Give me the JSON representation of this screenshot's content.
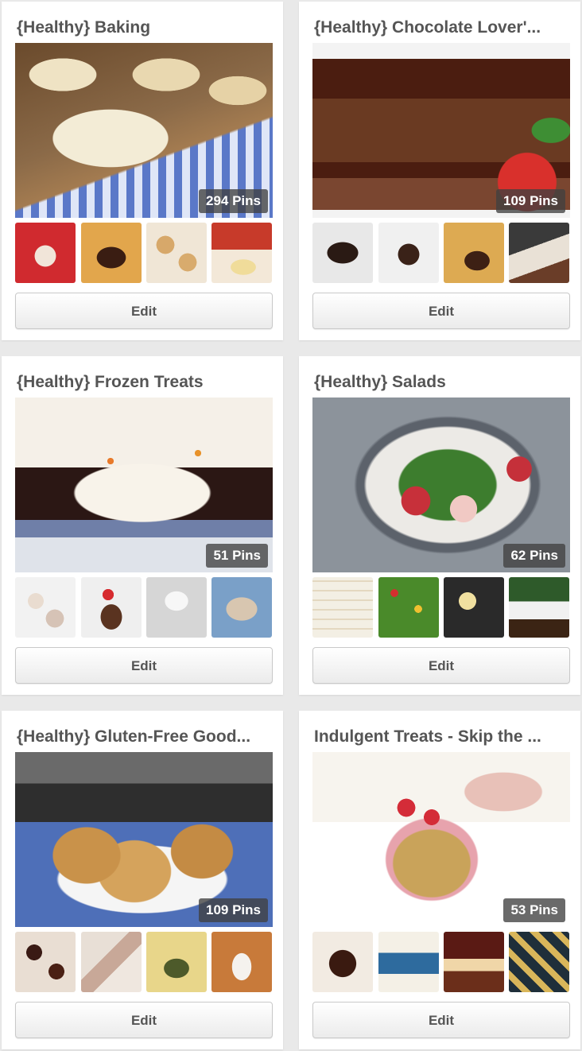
{
  "edit_label": "Edit",
  "boards": [
    {
      "title": "{Healthy} Baking",
      "pins": "294 Pins"
    },
    {
      "title": "{Healthy} Chocolate Lover'...",
      "pins": "109 Pins"
    },
    {
      "title": "{Healthy} Frozen Treats",
      "pins": "51 Pins"
    },
    {
      "title": "{Healthy} Salads",
      "pins": "62 Pins"
    },
    {
      "title": "{Healthy} Gluten-Free Good...",
      "pins": "109 Pins"
    },
    {
      "title": "Indulgent Treats - Skip the ...",
      "pins": "53 Pins"
    }
  ],
  "colors": {
    "page_background": "#e9e9e9",
    "card_background": "#ffffff",
    "title_text": "#555555",
    "badge_background": "#404040"
  }
}
